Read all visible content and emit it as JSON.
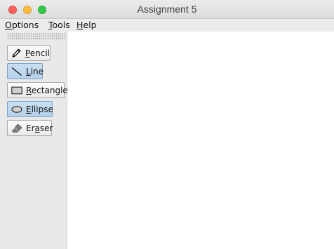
{
  "window": {
    "title": "Assignment 5"
  },
  "menubar": {
    "items": [
      {
        "mnemonic": "O",
        "rest": "ptions"
      },
      {
        "mnemonic": "T",
        "rest": "ools"
      },
      {
        "mnemonic": "H",
        "rest": "elp"
      }
    ]
  },
  "toolbar": {
    "tools": [
      {
        "icon": "pencil-icon",
        "pre": "",
        "mnemonic": "P",
        "post": "encil",
        "selected": false
      },
      {
        "icon": "line-icon",
        "pre": "",
        "mnemonic": "L",
        "post": "ine",
        "selected": true
      },
      {
        "icon": "rectangle-icon",
        "pre": "",
        "mnemonic": "R",
        "post": "ectangle",
        "selected": false
      },
      {
        "icon": "ellipse-icon",
        "pre": "",
        "mnemonic": "E",
        "post": "llipse",
        "selected": true
      },
      {
        "icon": "eraser-icon",
        "pre": "Er",
        "mnemonic": "a",
        "post": "ser",
        "selected": false
      }
    ]
  },
  "colors": {
    "selected_tool": "#b5d2ea",
    "toolbar_bg": "#e9e9e9",
    "canvas_bg": "#ffffff"
  }
}
